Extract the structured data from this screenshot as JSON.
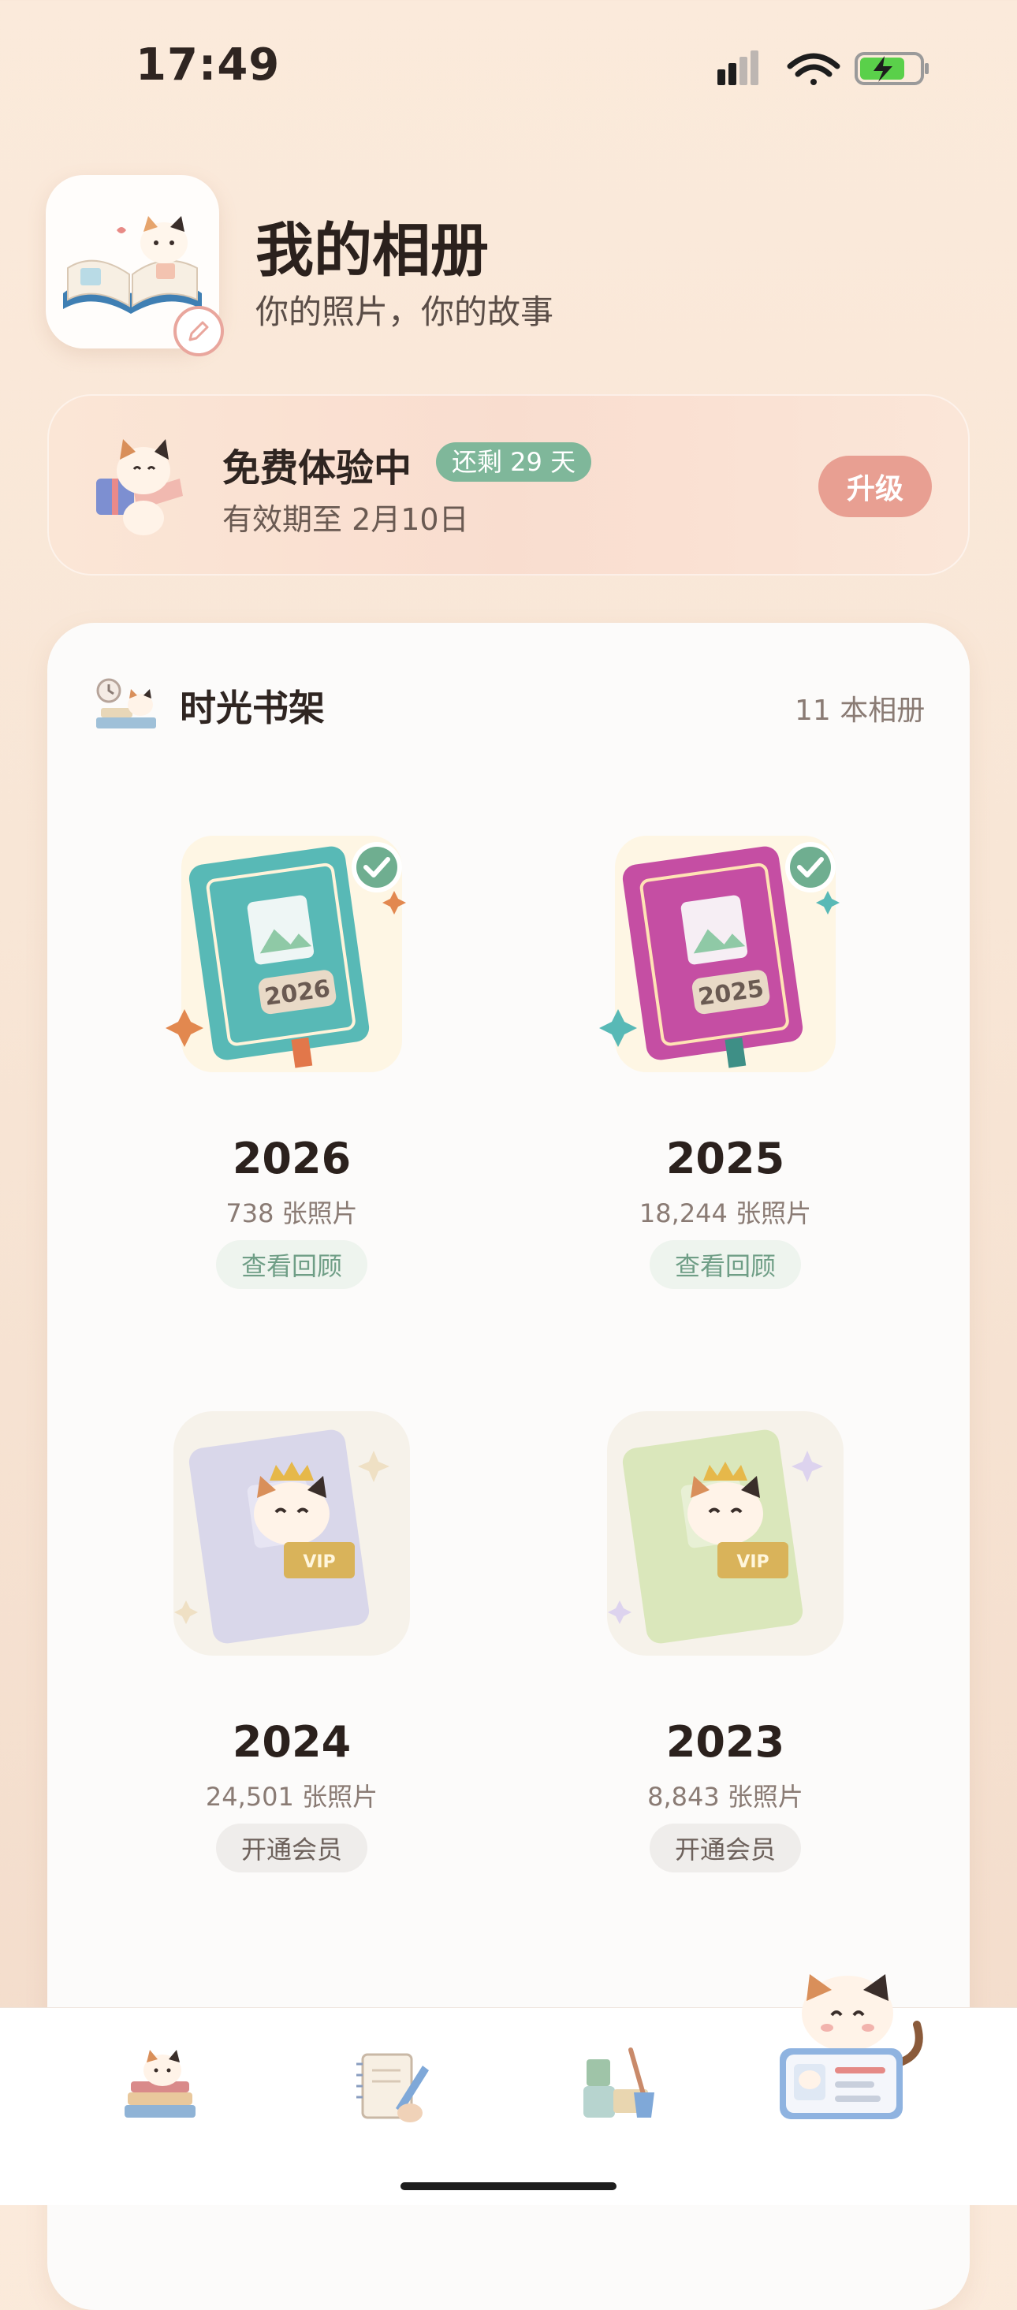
{
  "status_bar": {
    "time": "17:49"
  },
  "header": {
    "title": "我的相册",
    "subtitle": "你的照片，你的故事"
  },
  "trial": {
    "title": "免费体验中",
    "remaining": "还剩 29 天",
    "expiry": "有效期至 2月10日",
    "upgrade_label": "升级"
  },
  "shelf": {
    "title": "时光书架",
    "count": "11 本相册",
    "albums": [
      {
        "year": "2026",
        "photos": "738 张照片",
        "action": "查看回顾",
        "locked": false,
        "color": "#5fc0bd"
      },
      {
        "year": "2025",
        "photos": "18,244 张照片",
        "action": "查看回顾",
        "locked": false,
        "color": "#cc4fa8"
      },
      {
        "year": "2024",
        "photos": "24,501 张照片",
        "action": "开通会员",
        "locked": true,
        "color": "#c7c4ea"
      },
      {
        "year": "2023",
        "photos": "8,843 张照片",
        "action": "开通会员",
        "locked": true,
        "color": "#cfe3a7"
      }
    ]
  },
  "tabs": [
    {
      "icon": "cat-books-icon"
    },
    {
      "icon": "notebook-icon"
    },
    {
      "icon": "cleaning-icon"
    },
    {
      "icon": "cat-id-card-icon"
    }
  ],
  "colors": {
    "accent_green": "#7fb79a",
    "accent_pink": "#e89f92",
    "background": "#f8e6d6"
  }
}
